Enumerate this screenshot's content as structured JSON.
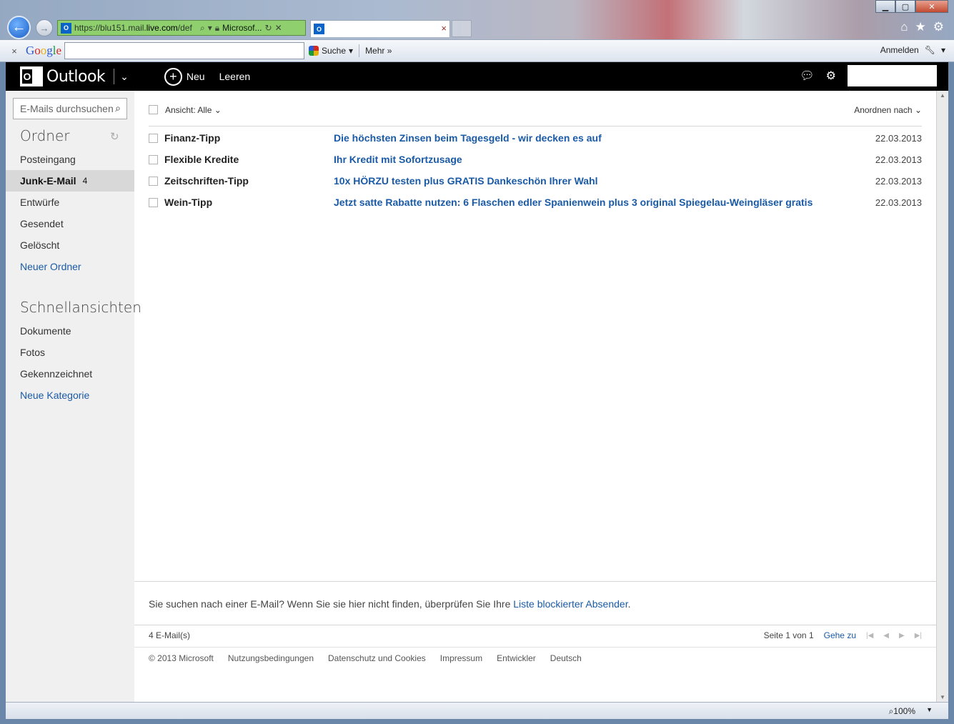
{
  "browser": {
    "url_prefix": "https://",
    "url_domain_dim": "blu151.mail.",
    "url_domain": "live.com",
    "url_path": "/def",
    "site_name": "Microsof...",
    "close_glyph": "✕",
    "minimize_glyph": "▁",
    "maximize_glyph": "▢",
    "tab_close": "×"
  },
  "google_toolbar": {
    "close": "×",
    "logo": {
      "G": "G",
      "o1": "o",
      "o2": "o",
      "g": "g",
      "l": "l",
      "e": "e"
    },
    "search_button": "Suche",
    "more": "Mehr",
    "signin": "Anmelden"
  },
  "header": {
    "app_name": "Outlook",
    "new_label": "Neu",
    "empty_label": "Leeren"
  },
  "sidebar": {
    "search_placeholder": "E-Mails durchsuchen",
    "folders_heading": "Ordner",
    "folders": [
      {
        "label": "Posteingang",
        "count": ""
      },
      {
        "label": "Junk-E-Mail",
        "count": "4"
      },
      {
        "label": "Entwürfe",
        "count": ""
      },
      {
        "label": "Gesendet",
        "count": ""
      },
      {
        "label": "Gelöscht",
        "count": ""
      }
    ],
    "new_folder": "Neuer Ordner",
    "quickviews_heading": "Schnellansichten",
    "quickviews": [
      "Dokumente",
      "Fotos",
      "Gekennzeichnet"
    ],
    "new_category": "Neue Kategorie"
  },
  "list": {
    "view_label": "Ansicht: Alle",
    "sort_label": "Anordnen nach",
    "messages": [
      {
        "from": "Finanz-Tipp",
        "subject": "Die höchsten Zinsen beim Tagesgeld - wir decken es auf",
        "date": "22.03.2013"
      },
      {
        "from": "Flexible Kredite",
        "subject": "Ihr Kredit mit Sofortzusage",
        "date": "22.03.2013"
      },
      {
        "from": "Zeitschriften-Tipp",
        "subject": "10x HÖRZU testen plus GRATIS Dankeschön Ihrer Wahl",
        "date": "22.03.2013"
      },
      {
        "from": "Wein-Tipp",
        "subject": "Jetzt satte Rabatte nutzen: 6 Flaschen edler Spanienwein plus 3 original Spiegelau-Weingläser gratis",
        "date": "22.03.2013"
      }
    ],
    "hint_text": "Sie suchen nach einer E-Mail? Wenn Sie sie hier nicht finden, überprüfen Sie Ihre ",
    "hint_link": "Liste blockierter Absender",
    "hint_end": ".",
    "count": "4 E-Mail(s)",
    "page_info": "Seite 1 von 1",
    "goto": "Gehe zu"
  },
  "footer": [
    "© 2013 Microsoft",
    "Nutzungsbedingungen",
    "Datenschutz und Cookies",
    "Impressum",
    "Entwickler",
    "Deutsch"
  ],
  "status": {
    "zoom": "100%"
  },
  "colors": {
    "link": "#1a5aa6",
    "header_bg": "#000000",
    "sidebar_bg": "#f0f0f0",
    "active_folder": "#d8d8d8"
  }
}
